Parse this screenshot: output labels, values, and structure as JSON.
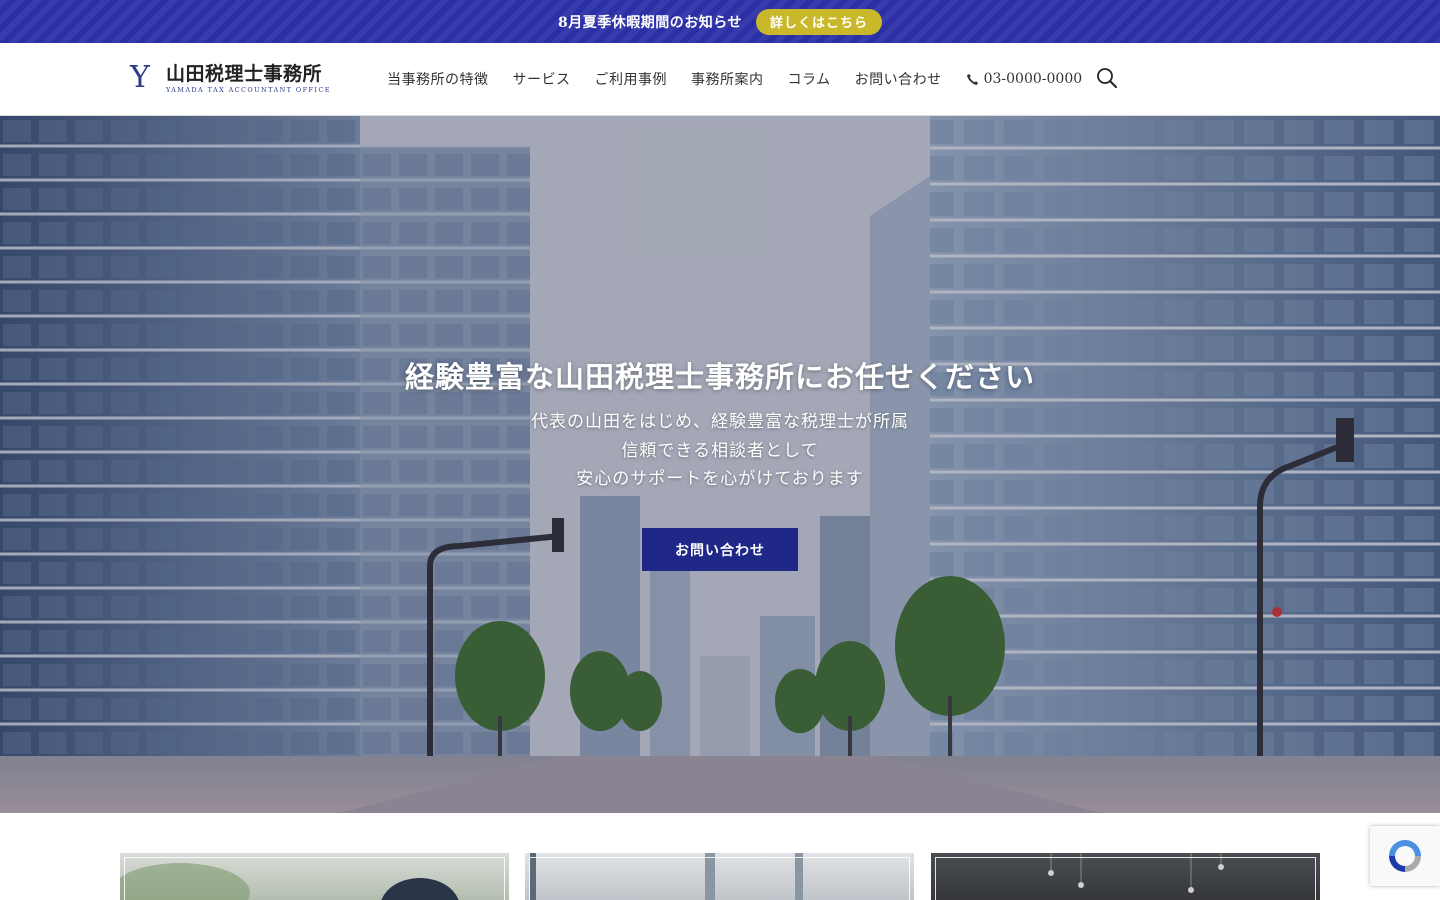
{
  "notice": {
    "text": "8月夏季休暇期間のお知らせ",
    "button_label": "詳しくはこちら"
  },
  "header": {
    "logo_mark": "Y",
    "logo_name": "山田税理士事務所",
    "logo_sub": "YAMADA TAX ACCOUNTANT OFFICE",
    "nav": [
      "当事務所の特徴",
      "サービス",
      "ご利用事例",
      "事務所案内",
      "コラム",
      "お問い合わせ"
    ],
    "phone": "03-0000-0000"
  },
  "hero": {
    "title": "経験豊富な山田税理士事務所にお任せください",
    "sub_lines": [
      "代表の山田をはじめ、経験豊富な税理士が所属",
      "信頼できる相談者として",
      "安心のサポートを心がけております"
    ],
    "cta_label": "お問い合わせ"
  },
  "colors": {
    "notice_bg": "#2b2fa6",
    "notice_button": "#c9b82a",
    "cta": "#1f2787",
    "logo_accent": "#2b3a8a"
  },
  "icons": {
    "phone": "phone-icon",
    "search": "search-icon",
    "recaptcha": "recaptcha-icon"
  }
}
